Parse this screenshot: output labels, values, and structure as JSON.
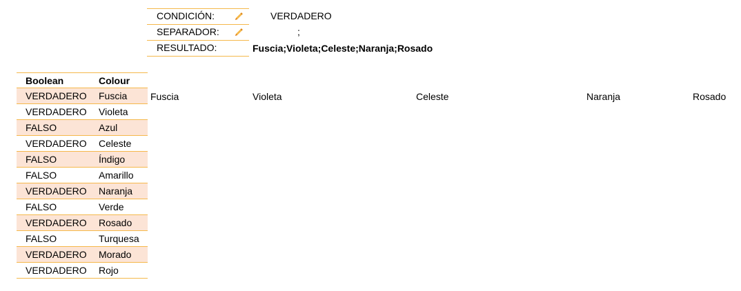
{
  "params": {
    "condicion": {
      "label": "CONDICIÓN:",
      "value": "VERDADERO"
    },
    "separador": {
      "label": "SEPARADOR:",
      "value": ";"
    },
    "resultado": {
      "label": "RESULTADO:",
      "value": "Fuscia;Violeta;Celeste;Naranja;Rosado"
    },
    "edit_icon": "pencil-icon",
    "accent_color": "#f5b84a",
    "shade_color": "#fce4d6"
  },
  "table": {
    "headers": {
      "boolean": "Boolean",
      "colour": "Colour"
    },
    "rows": [
      {
        "boolean": "VERDADERO",
        "colour": "Fuscia"
      },
      {
        "boolean": "VERDADERO",
        "colour": "Violeta"
      },
      {
        "boolean": "FALSO",
        "colour": "Azul"
      },
      {
        "boolean": "VERDADERO",
        "colour": "Celeste"
      },
      {
        "boolean": "FALSO",
        "colour": "Índigo"
      },
      {
        "boolean": "FALSO",
        "colour": "Amarillo"
      },
      {
        "boolean": "VERDADERO",
        "colour": "Naranja"
      },
      {
        "boolean": "FALSO",
        "colour": "Verde"
      },
      {
        "boolean": "VERDADERO",
        "colour": "Rosado"
      },
      {
        "boolean": "FALSO",
        "colour": "Turquesa"
      },
      {
        "boolean": "VERDADERO",
        "colour": "Morado"
      },
      {
        "boolean": "VERDADERO",
        "colour": "Rojo"
      }
    ]
  },
  "spill": [
    "Fuscia",
    "Violeta",
    "Celeste",
    "Naranja",
    "Rosado"
  ]
}
